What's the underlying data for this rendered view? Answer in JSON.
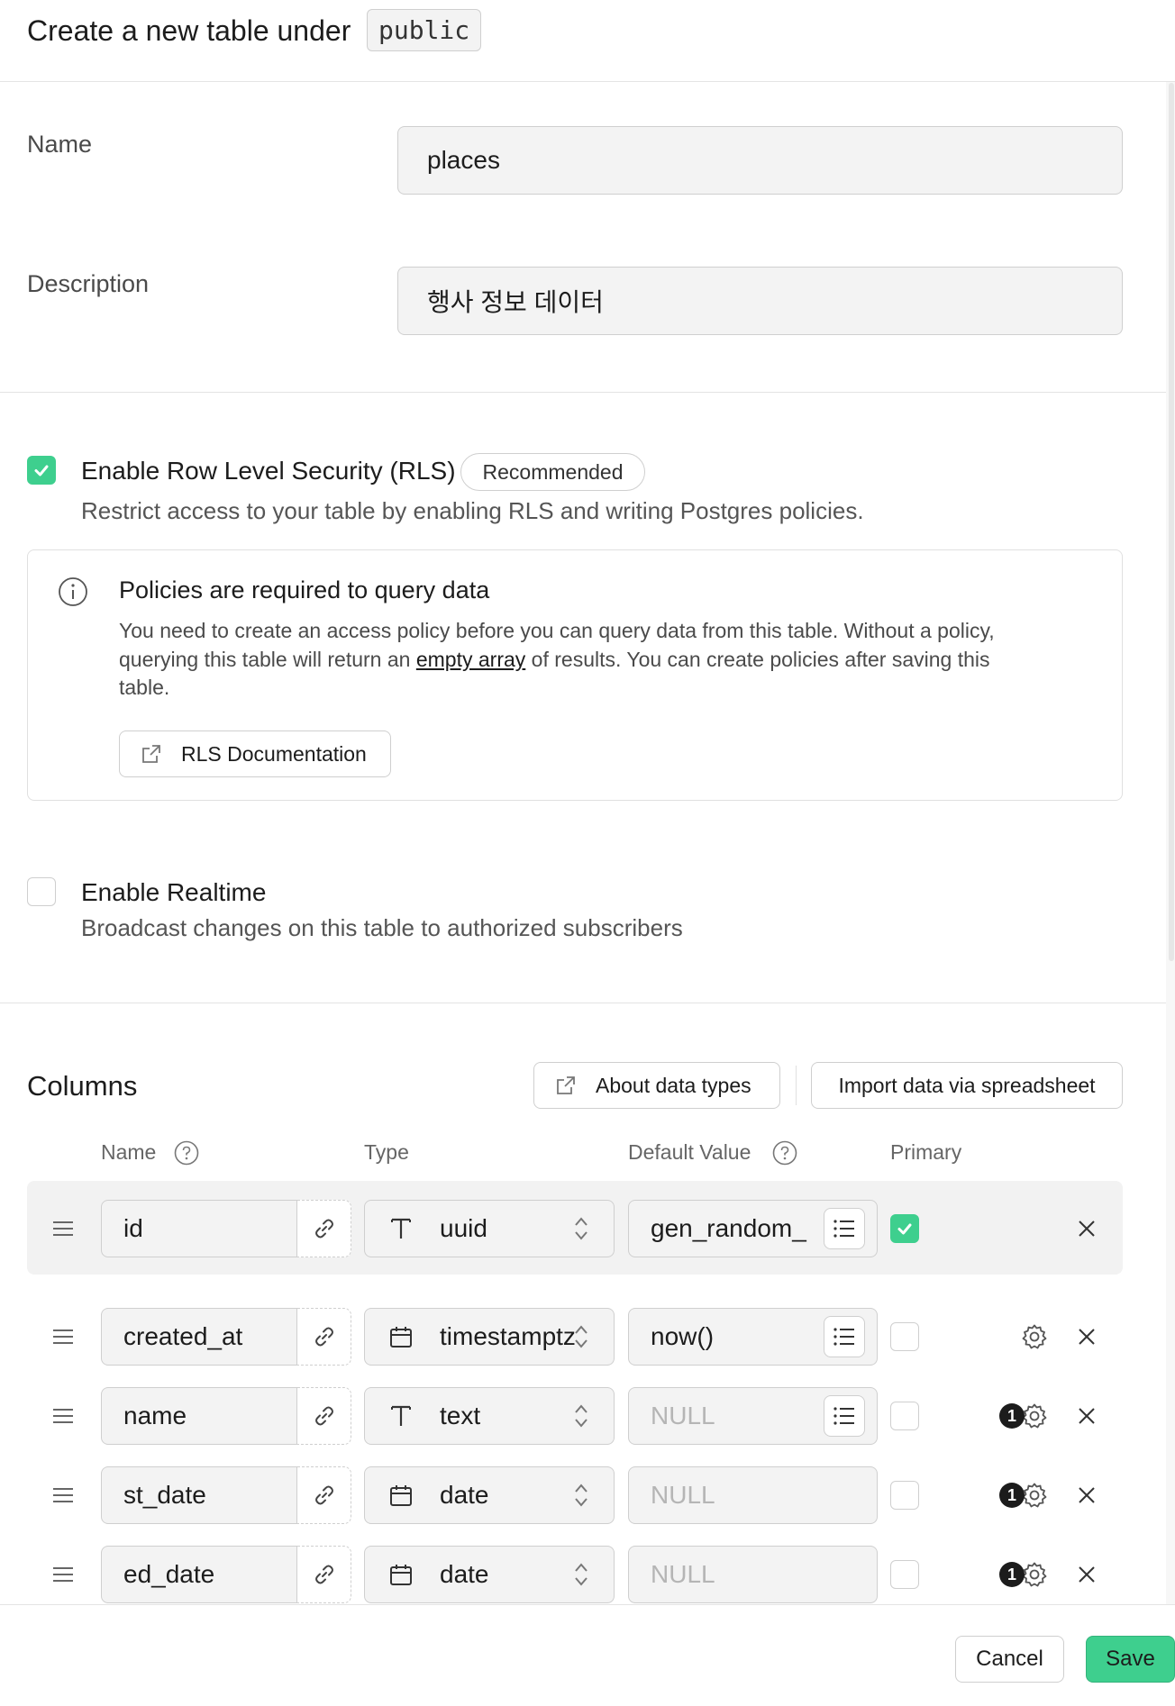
{
  "header": {
    "title": "Create a new table under",
    "schema": "public"
  },
  "form": {
    "name_label": "Name",
    "name_value": "places",
    "description_label": "Description",
    "description_value": "행사 정보 데이터"
  },
  "rls": {
    "enabled": true,
    "title": "Enable Row Level Security (RLS)",
    "badge": "Recommended",
    "description": "Restrict access to your table by enabling RLS and writing Postgres policies."
  },
  "policy_notice": {
    "title": "Policies are required to query data",
    "text_line1": "You need to create an access policy before you can query data from this table. Without a policy,",
    "text_line2_pre": "querying this table will return an ",
    "text_line2_link": "empty array",
    "text_line2_post": " of results. You can create policies after saving this",
    "text_line3": "table.",
    "doc_button": "RLS Documentation"
  },
  "realtime": {
    "enabled": false,
    "title": "Enable Realtime",
    "description": "Broadcast changes on this table to authorized subscribers"
  },
  "columns": {
    "title": "Columns",
    "about_button": "About data types",
    "import_button": "Import data via spreadsheet",
    "headers": {
      "name": "Name",
      "type": "Type",
      "default": "Default Value",
      "primary": "Primary"
    },
    "rows": [
      {
        "name": "id",
        "type": "uuid",
        "type_icon": "text-type-icon",
        "default": "gen_random_",
        "default_placeholder": false,
        "has_list": true,
        "primary": true,
        "badge": "",
        "settings": false
      },
      {
        "name": "created_at",
        "type": "timestamptz",
        "type_icon": "calendar-icon",
        "default": "now()",
        "default_placeholder": false,
        "has_list": true,
        "primary": false,
        "badge": "",
        "settings": true
      },
      {
        "name": "name",
        "type": "text",
        "type_icon": "text-type-icon",
        "default": "NULL",
        "default_placeholder": true,
        "has_list": true,
        "primary": false,
        "badge": "1",
        "settings": true
      },
      {
        "name": "st_date",
        "type": "date",
        "type_icon": "calendar-icon",
        "default": "NULL",
        "default_placeholder": true,
        "has_list": false,
        "primary": false,
        "badge": "1",
        "settings": true
      },
      {
        "name": "ed_date",
        "type": "date",
        "type_icon": "calendar-icon",
        "default": "NULL",
        "default_placeholder": true,
        "has_list": false,
        "primary": false,
        "badge": "1",
        "settings": true
      }
    ]
  },
  "footer": {
    "cancel": "Cancel",
    "save": "Save"
  },
  "colors": {
    "accent": "#3ecf8e"
  }
}
